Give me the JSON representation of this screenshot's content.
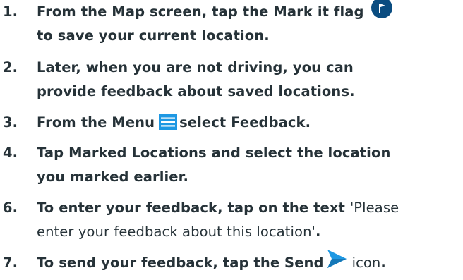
{
  "steps": [
    {
      "number": "1.",
      "line1_text": "From the Map screen, tap the Mark it flag",
      "icon": "flag-icon",
      "line2_text": "to save your current  location."
    },
    {
      "number": "2.",
      "line1_text": "Later, when you are not driving, you can",
      "line2_text": "provide feedback about saved locations."
    },
    {
      "number": "3.",
      "pre": "From the Menu",
      "icon": "menu-icon",
      "mid": "select",
      "bold": "Feedback",
      "post": "."
    },
    {
      "number": "4.",
      "pre": "Tap",
      "bold": "Marked Locations",
      "post": "and select the location",
      "line2_text": "you marked earlier."
    },
    {
      "number": "6.",
      "pre": "To enter your feedback, tap on the text",
      "quote_part1": "'Please",
      "quote_part2": "enter your feedback about this location'",
      "end": "."
    },
    {
      "number": "7.",
      "pre": "To send your feedback, tap the",
      "bold": "Send",
      "icon": "send-icon",
      "post": "icon",
      "end": "."
    }
  ],
  "colors": {
    "text": "#263238",
    "flag_icon_bg": "#0a4c80",
    "menu_icon_bg": "#1e98e3",
    "send_icon": "#1e98e3"
  }
}
